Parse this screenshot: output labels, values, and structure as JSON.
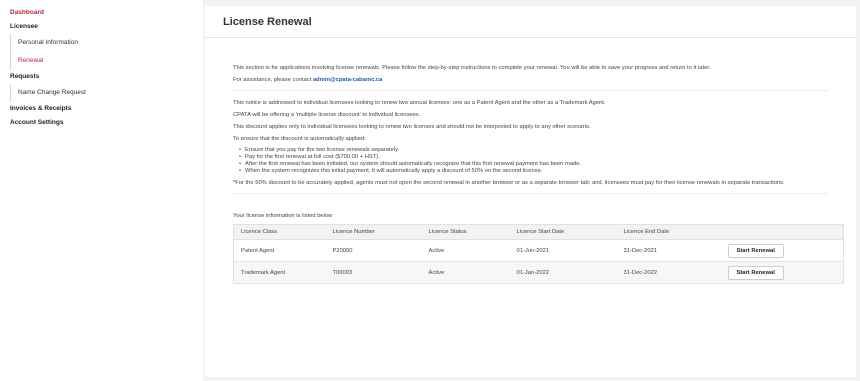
{
  "sidebar": {
    "dashboard": "Dashboard",
    "licensee": "Licensee",
    "personal_information": "Personal Information",
    "renewal": "Renewal",
    "requests": "Requests",
    "name_change_request": "Name Change Request",
    "invoices_receipts": "Invoices & Receipts",
    "account_settings": "Account Settings"
  },
  "page": {
    "title": "License Renewal",
    "intro": "This section is for applications involving license renewals. Please follow the step-by-step instructions to complete your renewal. You will be able to save your progress and return to it later.",
    "assistance_prefix": "For assistance, please contact",
    "email": "admin@cpata-cabamc.ca",
    "notice1": "This notice is addressed to individual licensees looking to renew two annual licenses: one as a Patent Agent and the other as a Trademark Agent.",
    "notice2": "CPATA will be offering a 'multiple license discount' to individual licensees.",
    "notice3": "This discount applies only to individual licensees looking to renew two licenses and should not be interpreted to apply to any other scenario.",
    "notice4": "To ensure that the discount is automatically applied:",
    "bullets": [
      "Ensure that you pay for the two license renewals separately.",
      "Pay for the first renewal at full cost ($700.00 + HST).",
      "After the first renewal has been initiated, our system should automatically recognize that this first renewal payment has been made.",
      "When the system recognizes this initial payment, it will automatically apply a discount of 50% on the second license."
    ],
    "footnote": "*For the 50% discount to be accurately applied, agents must not open the second renewal in another browser or as a separate browser tab; and, licensees must pay for their license renewals in separate transactions.",
    "table_intro": "Your license information is listed below"
  },
  "table": {
    "headers": [
      "Licence Class",
      "Licence Number",
      "Licence Status",
      "Licence Start Date",
      "Licence End Date",
      ""
    ],
    "rows": [
      [
        "Patent Agent",
        "P20000",
        "Active",
        "01-Jun-2021",
        "31-Dec-2021",
        "Start Renewal"
      ],
      [
        "Trademark Agent",
        "T00003",
        "Active",
        "01-Jan-2022",
        "31-Dec-2022",
        "Start Renewal"
      ]
    ]
  },
  "colors": {
    "accent": "#b8283b",
    "link": "#1f5ea8"
  }
}
